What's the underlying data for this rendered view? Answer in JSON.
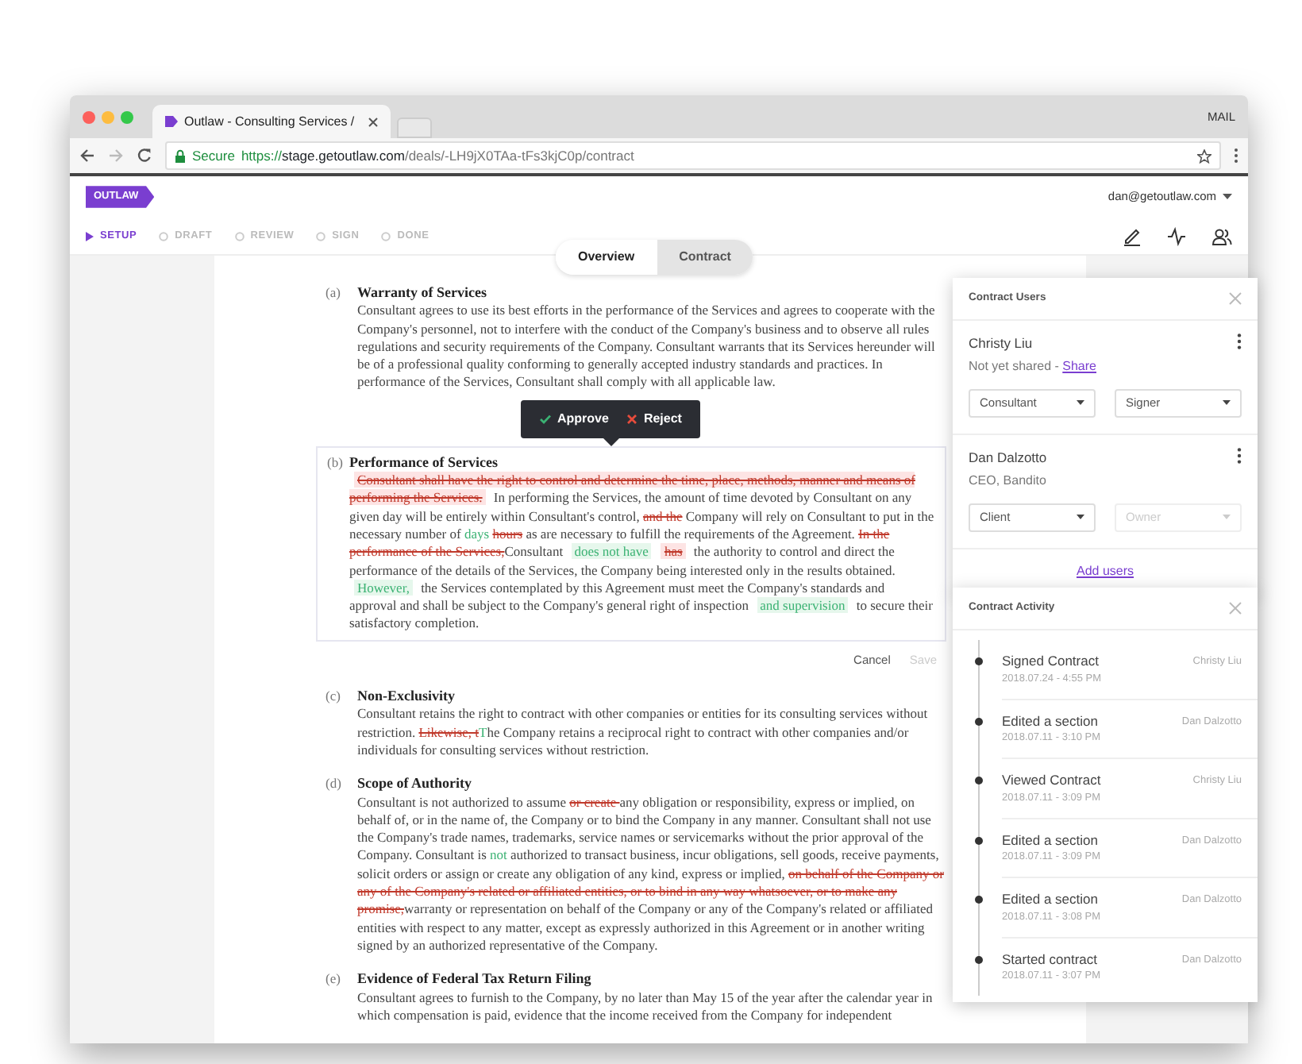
{
  "browser": {
    "tab_title": "Outlaw - Consulting Services /",
    "corner_label": "MAIL",
    "security_label": "Secure",
    "url": {
      "scheme": "https://",
      "host": "stage.getoutlaw.com",
      "path": "/deals/-LH9jX0TAa-tFs3kjC0p/contract"
    }
  },
  "app": {
    "logo": "OUTLAW",
    "user_email": "dan@getoutlaw.com"
  },
  "steps": [
    {
      "label": "SETUP",
      "selected": true
    },
    {
      "label": "DRAFT",
      "selected": false
    },
    {
      "label": "REVIEW",
      "selected": false
    },
    {
      "label": "SIGN",
      "selected": false
    },
    {
      "label": "DONE",
      "selected": false
    }
  ],
  "view_toggle": [
    {
      "label": "Overview",
      "selected": true
    },
    {
      "label": "Contract",
      "selected": false
    }
  ],
  "review_popover": {
    "approve": "Approve",
    "reject": "Reject"
  },
  "sections": [
    {
      "label": "(a)",
      "title": "Warranty of Services",
      "editing": false,
      "segments": [
        {
          "kind": "plain",
          "text": "Consultant agrees to use its best efforts in the performance of the Services and agrees to cooperate with the Company's personnel, not to interfere with the conduct of the Company's business and to observe all rules regulations and security requirements of the Company. Consultant warrants that its Services hereunder will be of a professional quality conforming to generally accepted industry standards and practices. In performance of the Services, Consultant shall comply with all applicable law."
        }
      ]
    },
    {
      "label": "(b)",
      "title": "Performance of Services",
      "editing": true,
      "segments": [
        {
          "kind": "deleted",
          "highlighted": true,
          "text": "Consultant shall have the right to control and determine the time, place, methods, manner and means of performing the Services."
        },
        {
          "kind": "plain",
          "text": " In performing the Services, the amount of time devoted by Consultant on any given day will be entirely within Consultant's control, "
        },
        {
          "kind": "deleted",
          "highlighted": false,
          "text": "and the"
        },
        {
          "kind": "plain",
          "text": " Company will rely on Consultant to put in the necessary number of "
        },
        {
          "kind": "inserted",
          "highlighted": false,
          "text": "days "
        },
        {
          "kind": "deleted",
          "highlighted": false,
          "text": "hours"
        },
        {
          "kind": "plain",
          "text": " as are necessary to fulfill the requirements of the Agreement. "
        },
        {
          "kind": "deleted",
          "highlighted": false,
          "text": "In the performance of the Services,"
        },
        {
          "kind": "plain",
          "text": "Consultant "
        },
        {
          "kind": "inserted",
          "highlighted": true,
          "text": "does not have"
        },
        {
          "kind": "deleted",
          "highlighted": true,
          "text": "has"
        },
        {
          "kind": "plain",
          "text": " the authority to control and direct the performance of the details of the Services, the Company being interested only in the results obtained. "
        },
        {
          "kind": "inserted",
          "highlighted": true,
          "text": "However,"
        },
        {
          "kind": "plain",
          "text": " the Services contemplated by this Agreement must meet the Company's standards and approval and shall be subject to the Company's general right of inspection "
        },
        {
          "kind": "inserted",
          "highlighted": true,
          "text": "and supervision"
        },
        {
          "kind": "plain",
          "text": " to secure their satisfactory completion."
        }
      ],
      "actions": [
        {
          "label": "Cancel",
          "disabled": false
        },
        {
          "label": "Save",
          "disabled": true
        }
      ]
    },
    {
      "label": "(c)",
      "title": "Non-Exclusivity",
      "editing": false,
      "segments": [
        {
          "kind": "plain",
          "text": "Consultant retains the right to contract with other companies or entities for its consulting services without restriction. "
        },
        {
          "kind": "deleted",
          "highlighted": false,
          "text": "Likewise, t"
        },
        {
          "kind": "inserted",
          "highlighted": false,
          "text": "T"
        },
        {
          "kind": "plain",
          "text": "he Company retains a reciprocal right to contract with other companies and/or individuals for consulting services without restriction."
        }
      ]
    },
    {
      "label": "(d)",
      "title": "Scope of Authority",
      "editing": false,
      "segments": [
        {
          "kind": "plain",
          "text": "Consultant is not authorized to assume "
        },
        {
          "kind": "deleted",
          "highlighted": false,
          "text": "or create "
        },
        {
          "kind": "plain",
          "text": "any obligation or responsibility, express or implied, on behalf of, or in the name of, the Company or to bind the Company in any manner. Consultant shall not use the Company's trade names, trademarks, service names or servicemarks without the prior approval of the Company. Consultant is "
        },
        {
          "kind": "inserted",
          "highlighted": false,
          "text": "not"
        },
        {
          "kind": "plain",
          "text": " authorized to transact business, incur obligations, sell goods, receive payments, solicit orders or assign or create any obligation of any kind, express or implied, "
        },
        {
          "kind": "deleted",
          "highlighted": false,
          "text": "on behalf of the Company or any of the Company's related or affiliated entities, or to bind in any way whatsoever, or to make any promise,"
        },
        {
          "kind": "plain",
          "text": "warranty or representation on behalf of the Company or any of the Company's related or affiliated entities with respect to any matter, except as expressly authorized in this Agreement or in another writing signed by an authorized representative of the Company."
        }
      ]
    },
    {
      "label": "(e)",
      "title": "Evidence of Federal Tax Return Filing",
      "editing": false,
      "segments": [
        {
          "kind": "plain",
          "text": "Consultant agrees to furnish to the Company, by no later than May 15 of the year after the calendar year in which compensation is paid, evidence that the income received from the Company for independent"
        }
      ]
    }
  ],
  "contract_users": {
    "title": "Contract Users",
    "users": [
      {
        "name": "Christy Liu",
        "status": "Not yet shared - ",
        "status_link": "Share",
        "role": "Consultant",
        "permission": {
          "value": "Signer",
          "disabled": false
        }
      },
      {
        "name": "Dan Dalzotto",
        "status": "CEO, Bandito",
        "role": "Client",
        "permission": {
          "value": "Owner",
          "disabled": true
        }
      }
    ],
    "add_link": "Add users"
  },
  "contract_activity": {
    "title": "Contract Activity",
    "events": [
      {
        "action": "Signed Contract",
        "time": "2018.07.24 - 4:55 PM",
        "user": "Christy Liu"
      },
      {
        "action": "Edited a section",
        "time": "2018.07.11 - 3:10 PM",
        "user": "Dan Dalzotto"
      },
      {
        "action": "Viewed Contract",
        "time": "2018.07.11 - 3:09 PM",
        "user": "Christy Liu"
      },
      {
        "action": "Edited a section",
        "time": "2018.07.11 - 3:09 PM",
        "user": "Dan Dalzotto"
      },
      {
        "action": "Edited a section",
        "time": "2018.07.11 - 3:08 PM",
        "user": "Dan Dalzotto"
      },
      {
        "action": "Started contract",
        "time": "2018.07.11 - 3:07 PM",
        "user": "Dan Dalzotto"
      }
    ]
  }
}
